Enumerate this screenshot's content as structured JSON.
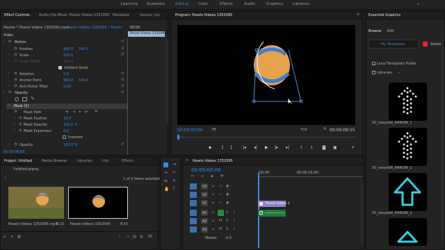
{
  "workspaces": {
    "items": [
      "Learning",
      "Assembly",
      "Editing",
      "Color",
      "Effects",
      "Audio",
      "Graphics",
      "Libraries"
    ],
    "active": "Editing"
  },
  "effect_controls": {
    "tabs": [
      "Effect Controls",
      "Audio Clip Mixer: Pexels Videos 1352095",
      "Metadata",
      "Source: (no"
    ],
    "master": "Master * Pexels Videos 1352095.mp4",
    "sequence": "Pexels Videos 1352095 * Pexels",
    "time_ruler": "00:00",
    "clip_name": "Pexels Videos 1352095",
    "section": "Video",
    "motion": "Motion",
    "position": {
      "label": "Position",
      "x": "960.0",
      "y": "540.0"
    },
    "scale": {
      "label": "Scale",
      "value": "100.0"
    },
    "scale_width": {
      "label": "Scale Width",
      "value": "100.0"
    },
    "uniform": "Uniform Scale",
    "rotation": {
      "label": "Rotation",
      "value": "0.0"
    },
    "anchor": {
      "label": "Anchor Point",
      "x": "960.0",
      "y": "540.0"
    },
    "antiflicker": {
      "label": "Anti-flicker Filter",
      "value": "0.00"
    },
    "opacity_section": "Opacity",
    "mask": "Mask (1)",
    "mask_path": "Mask Path",
    "mask_feather": {
      "label": "Mask Feather",
      "value": "10.0"
    },
    "mask_opacity": {
      "label": "Mask Opacity",
      "value": "100.0 %"
    },
    "mask_expansion": {
      "label": "Mask Expansion",
      "value": "0.0"
    },
    "inverted": "Inverted",
    "opacity": {
      "label": "Opacity",
      "value": "100.0 %"
    },
    "timecode": "00:00:00:00"
  },
  "program": {
    "title": "Program: Pexels Videos 1352095",
    "timecode_left": "00:00:00:00",
    "fit": "Fit",
    "quality": "Full",
    "timecode_right": "00:00:09:15"
  },
  "essential_graphics": {
    "title": "Essential Graphics",
    "tabs": [
      "Browse",
      "Edit"
    ],
    "my_templates": "My Templates",
    "adobe": "Adobe",
    "local_folder": "Local Templates Folder",
    "libraries": "Libraries",
    "items": [
      "S0_easyedit_ARROW_1",
      "S0_easyedit_ARROW_1",
      "S0_easyedit_ARROW_2"
    ],
    "colors": {
      "white_arrow": "#e8e8e8",
      "cyan_arrow": "#2fd6e6"
    }
  },
  "project": {
    "tabs": [
      "Project: Untitled",
      "Media Browser",
      "Libraries",
      "Info",
      "Effects"
    ],
    "file": "Untitled.prproj",
    "selection": "1 of 2 items selected",
    "items": [
      {
        "name": "Pexels Videos 1352095.mp4",
        "duration": "9:15"
      },
      {
        "name": "Pexels Videos 1352095",
        "duration": "9:15"
      }
    ]
  },
  "timeline": {
    "title": "Pexels Videos 1352095",
    "timecode": "00:00:00:00",
    "ruler": [
      ":00:00",
      "00:00:15:00"
    ],
    "video_tracks": [
      "V3",
      "V2",
      "V1"
    ],
    "audio_tracks": [
      "A1",
      "A2",
      "A3"
    ],
    "master_label": "Master",
    "master_value": "0.0",
    "clip_label": "Pexels Videos 1"
  }
}
